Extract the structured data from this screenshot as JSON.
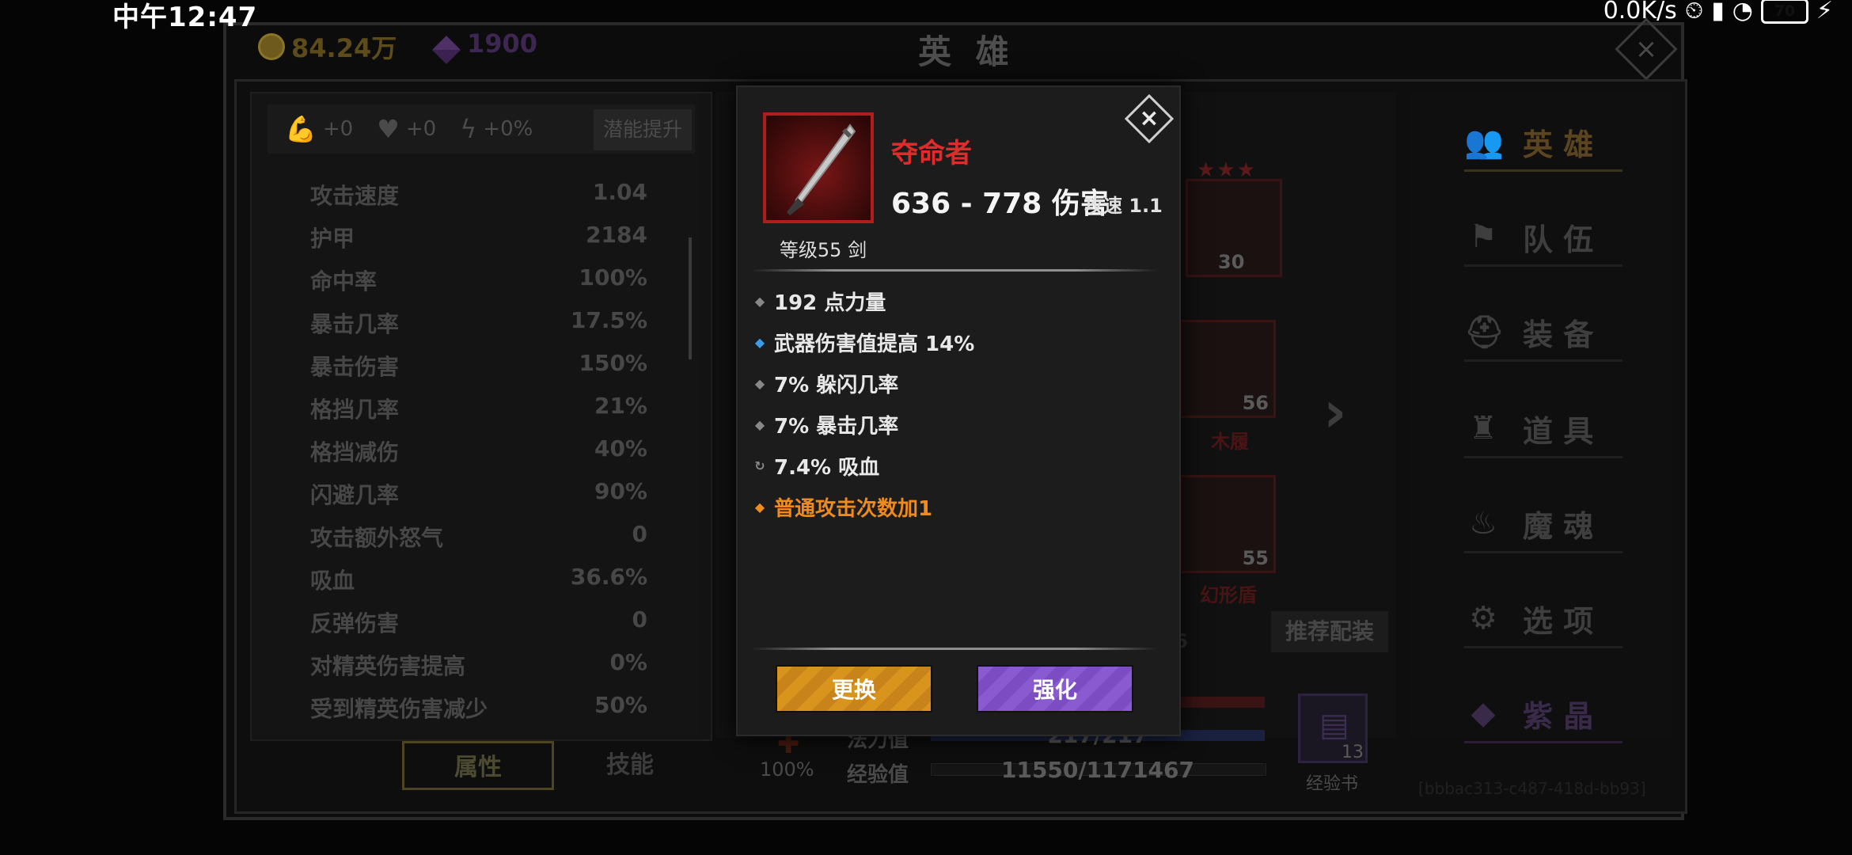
{
  "status_bar": {
    "time": "中午12:47",
    "net_speed": "0.0K/s",
    "battery": "70"
  },
  "header": {
    "gold": "84.24万",
    "gems": "1900",
    "title": "英 雄"
  },
  "buffs": {
    "strength": "+0",
    "health": "+0",
    "speed": "+0%",
    "potential_button": "潜能提升"
  },
  "stats": [
    {
      "label": "攻击速度",
      "value": "1.04"
    },
    {
      "label": "护甲",
      "value": "2184"
    },
    {
      "label": "命中率",
      "value": "100%"
    },
    {
      "label": "暴击几率",
      "value": "17.5%"
    },
    {
      "label": "暴击伤害",
      "value": "150%"
    },
    {
      "label": "格挡几率",
      "value": "21%"
    },
    {
      "label": "格挡减伤",
      "value": "40%"
    },
    {
      "label": "闪避几率",
      "value": "90%"
    },
    {
      "label": "攻击额外怒气",
      "value": "0"
    },
    {
      "label": "吸血",
      "value": "36.6%"
    },
    {
      "label": "反弹伤害",
      "value": "0"
    },
    {
      "label": "对精英伤害提高",
      "value": "0%"
    },
    {
      "label": "受到精英伤害减少",
      "value": "50%"
    }
  ],
  "bottom_tabs": {
    "attributes": "属性",
    "skills": "技能"
  },
  "equipment": {
    "slots": [
      {
        "level": "30",
        "name": ""
      },
      {
        "level": "56",
        "name": "木履"
      },
      {
        "level": "55",
        "name": "幻形盾"
      }
    ],
    "hidden_number": "6",
    "recommend_button": "推荐配装",
    "mana_label": "法力值",
    "mana_value": "217/217",
    "exp_label": "经验值",
    "exp_value": "11550/1171467",
    "percent": "100%",
    "exp_book_count": "13",
    "exp_book_label": "经验书",
    "faint_id": "[bbbac313-c487-418d-bb93]"
  },
  "side_menu": [
    {
      "label": "英 雄",
      "icon": "users-icon"
    },
    {
      "label": "队 伍",
      "icon": "flag-icon"
    },
    {
      "label": "装 备",
      "icon": "helmet-icon"
    },
    {
      "label": "道 具",
      "icon": "bag-icon"
    },
    {
      "label": "魔 魂",
      "icon": "flame-icon"
    },
    {
      "label": "选 项",
      "icon": "gear-icon"
    },
    {
      "label": "紫 晶",
      "icon": "crystal-icon"
    }
  ],
  "popup": {
    "weapon_name": "夺命者",
    "damage": "636 - 778 伤害",
    "attack_speed": "攻速 1.1",
    "level_text": "等级55 剑",
    "attributes": [
      {
        "text": "192 点力量",
        "style": "gray"
      },
      {
        "text": "武器伤害值提高 14%",
        "style": "blue"
      },
      {
        "text": "7% 躲闪几率",
        "style": "gray"
      },
      {
        "text": "7% 暴击几率",
        "style": "gray"
      },
      {
        "text": "7.4% 吸血",
        "style": "gray"
      },
      {
        "text": "普通攻击次数加1",
        "style": "orange"
      }
    ],
    "replace_button": "更换",
    "enhance_button": "强化"
  },
  "colors": {
    "weapon_name": "#e02b2b",
    "special_attr": "#ef8a1c",
    "replace_btn": "#d8941c",
    "enhance_btn": "#8a5ad0"
  }
}
